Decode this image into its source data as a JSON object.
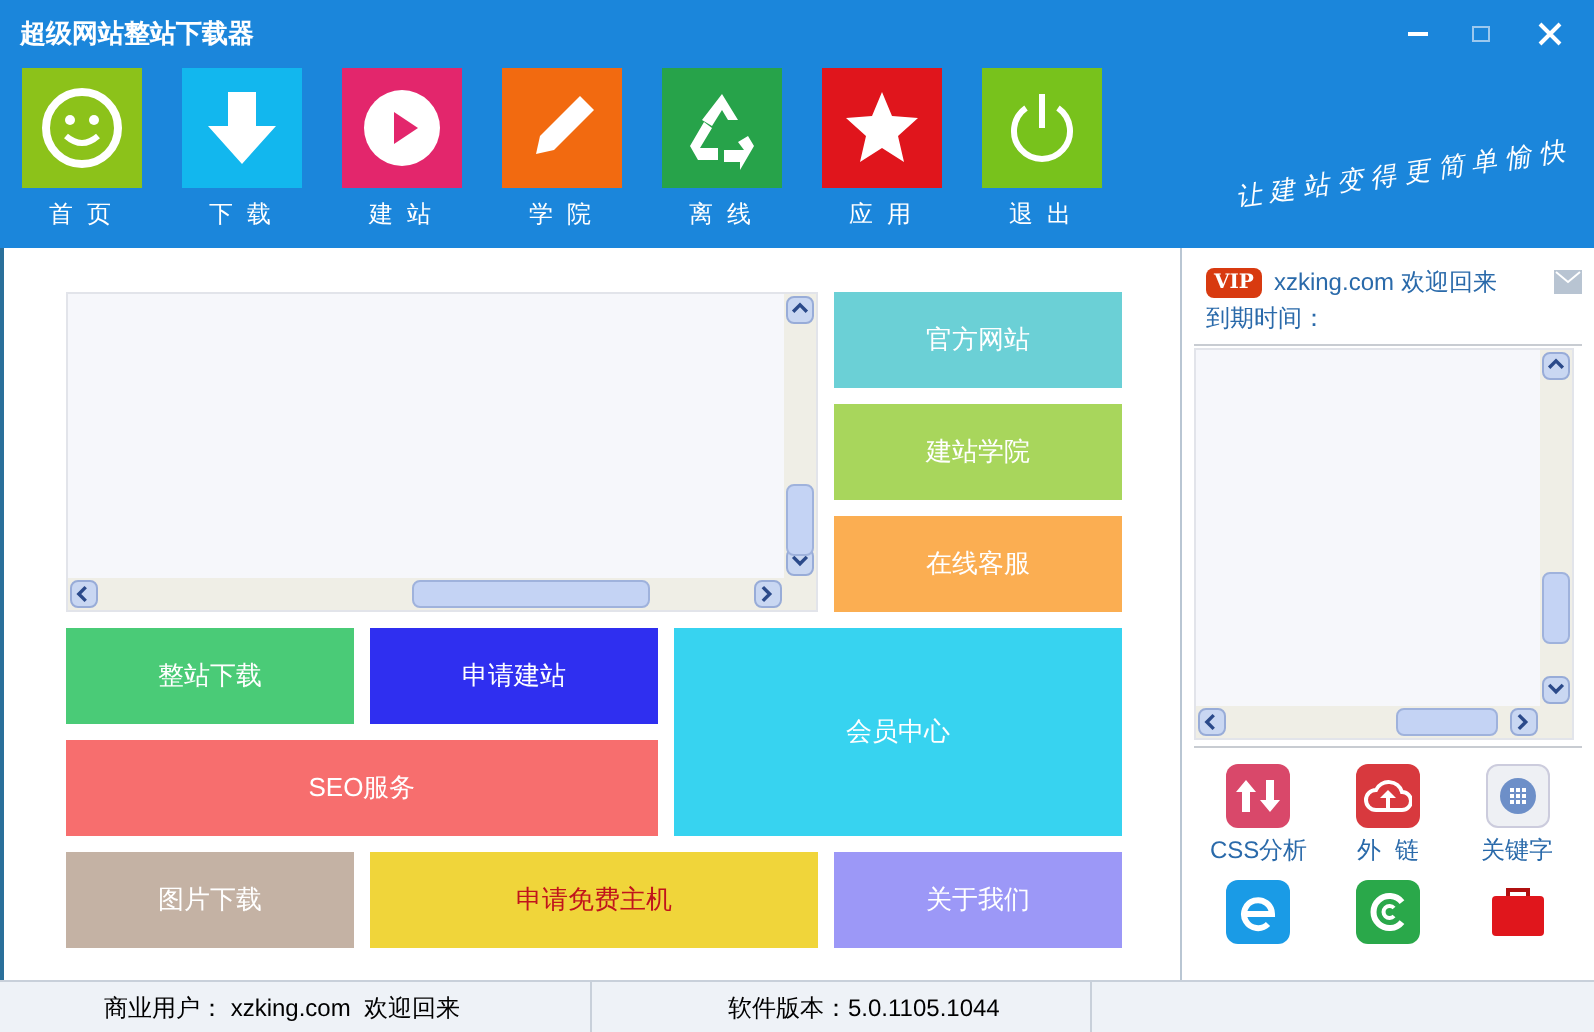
{
  "window": {
    "title": "超级网站整站下载器"
  },
  "slogan": "让建站变得更简单愉快",
  "toolbar": [
    {
      "label": "首 页",
      "kind": "smile",
      "color": "#8cc21a"
    },
    {
      "label": "下 载",
      "kind": "download",
      "color": "#12b7ee"
    },
    {
      "label": "建 站",
      "kind": "play",
      "color": "#e3266c"
    },
    {
      "label": "学 院",
      "kind": "pencil",
      "color": "#f26a10"
    },
    {
      "label": "离 线",
      "kind": "recycle",
      "color": "#27a34a"
    },
    {
      "label": "应 用",
      "kind": "star",
      "color": "#e0151c"
    },
    {
      "label": "退 出",
      "kind": "power",
      "color": "#78c21c"
    }
  ],
  "side_buttons": [
    {
      "label": "官方网站",
      "color": "#6bd0d6"
    },
    {
      "label": "建站学院",
      "color": "#a8d65c"
    },
    {
      "label": "在线客服",
      "color": "#fbae52"
    }
  ],
  "tiles": [
    {
      "label": "整站下载",
      "color": "#4acb77"
    },
    {
      "label": "申请建站",
      "color": "#2f2ff0"
    },
    {
      "label": "会员中心",
      "color": "#37d3f0"
    },
    {
      "label": "SEO服务",
      "color": "#f76e6e"
    },
    {
      "label": "图片下载",
      "color": "#c4b2a4"
    },
    {
      "label": "申请免费主机",
      "color": "#f0d53a"
    },
    {
      "label": "关于我们",
      "color": "#9c98f7"
    }
  ],
  "account": {
    "badge": "VIP",
    "welcome": "xzking.com 欢迎回来",
    "expiry": "到期时间："
  },
  "tools": [
    {
      "label": "CSS分析",
      "kind": "updown"
    },
    {
      "label": "外  链",
      "kind": "cloud"
    },
    {
      "label": "关键字",
      "kind": "grid"
    },
    {
      "kind": "ie"
    },
    {
      "kind": "torrent"
    },
    {
      "kind": "toolbox"
    }
  ],
  "status_bar": {
    "user": "商业用户： xzking.com  欢迎回来",
    "version": "软件版本：5.0.1105.1044"
  }
}
